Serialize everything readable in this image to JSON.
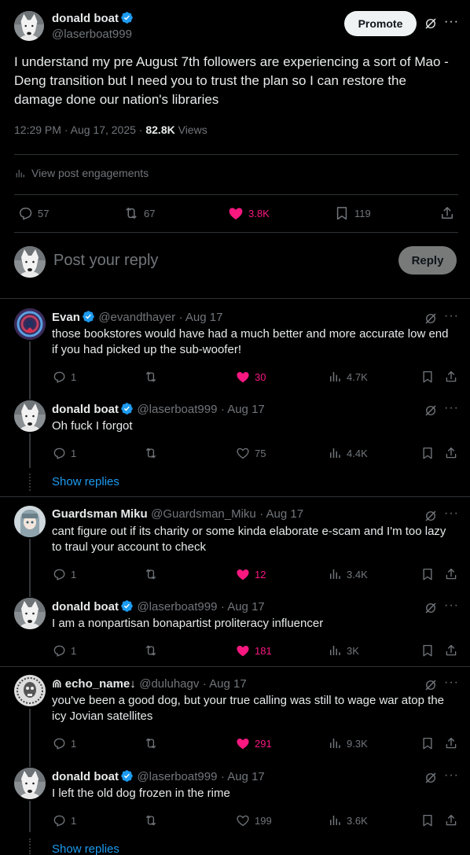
{
  "post": {
    "author_name": "donald boat",
    "author_handle": "@laserboat999",
    "promote_label": "Promote",
    "text": "I understand my pre August 7th followers are experiencing a sort of Mao - Deng transition but I need you to trust the plan so I can restore the damage done our nation's libraries",
    "time": "12:29 PM",
    "date": "Aug 17, 2025",
    "views_count": "82.8K",
    "views_label": "Views",
    "engagements_label": "View post engagements",
    "stats": {
      "replies": "57",
      "reposts": "67",
      "likes": "3.8K",
      "bookmarks": "119"
    }
  },
  "composer": {
    "placeholder": "Post your reply",
    "reply_label": "Reply"
  },
  "replies": [
    {
      "name": "Evan",
      "handle": "@evandthayer",
      "date": "· Aug 17",
      "text": "those bookstores would have had a much better and more accurate low end if you had picked up the sub-woofer!",
      "replies": "1",
      "likes": "30",
      "views": "4.7K"
    },
    {
      "name": "donald boat",
      "handle": "@laserboat999",
      "date": "· Aug 17",
      "text": "Oh fuck I forgot",
      "replies": "1",
      "likes": "75",
      "views": "4.4K"
    },
    {
      "name": "Guardsman Miku",
      "handle": "@Guardsman_Miku",
      "date": "· Aug 17",
      "text": "cant figure out if its charity or some kinda elaborate e-scam and I'm too lazy to traul your account to check",
      "replies": "1",
      "likes": "12",
      "views": "3.4K"
    },
    {
      "name": "donald boat",
      "handle": "@laserboat999",
      "date": "· Aug 17",
      "text": "I am a nonpartisan bonapartist proliteracy influencer",
      "replies": "1",
      "likes": "181",
      "views": "3K"
    },
    {
      "name": "⋒ echo_name↓",
      "handle": "@duluhagv",
      "date": "· Aug 17",
      "text": "you've been a good dog, but your true calling was still to wage war atop the icy Jovian satellites",
      "replies": "1",
      "likes": "291",
      "views": "9.3K"
    },
    {
      "name": "donald boat",
      "handle": "@laserboat999",
      "date": "· Aug 17",
      "text": "I left the old dog frozen in the rime",
      "replies": "1",
      "likes": "199",
      "views": "3.6K"
    }
  ],
  "show_replies_label": "Show replies",
  "colors": {
    "accent": "#1d9bf0",
    "like": "#f91880",
    "muted": "#71767b",
    "text": "#e7e9ea",
    "divider": "#2f3336"
  },
  "icons": [
    "verified-badge-icon",
    "grok-icon",
    "more-icon",
    "reply-icon",
    "repost-icon",
    "like-icon",
    "views-icon",
    "bookmark-icon",
    "share-icon"
  ]
}
